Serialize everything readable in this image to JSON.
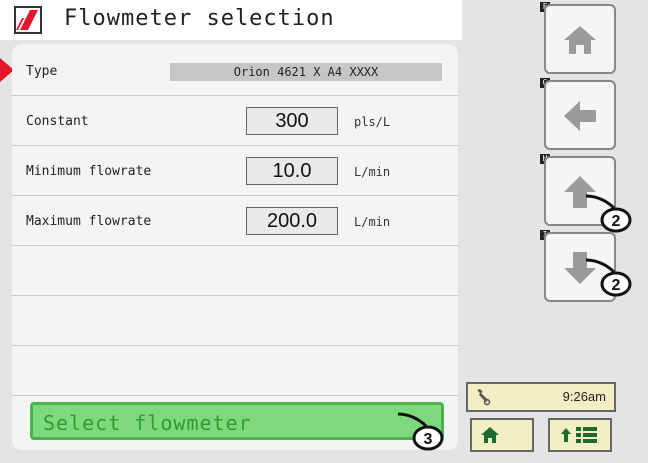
{
  "header": {
    "title": "Flowmeter selection"
  },
  "rows": [
    {
      "label": "Type",
      "value": "Orion 4621 X A4 XXXX"
    },
    {
      "label": "Constant",
      "value": "300",
      "unit": "pls/L"
    },
    {
      "label": "Minimum flowrate",
      "value": "10.0",
      "unit": "L/min"
    },
    {
      "label": "Maximum flowrate",
      "value": "200.0",
      "unit": "L/min"
    }
  ],
  "actions": {
    "select_label": "Select flowmeter"
  },
  "side_keys": [
    {
      "tag": "F",
      "icon": "home-icon"
    },
    {
      "tag": "G",
      "icon": "arrow-left-icon"
    },
    {
      "tag": "H",
      "icon": "arrow-up-icon"
    },
    {
      "tag": "I",
      "icon": "arrow-down-icon"
    }
  ],
  "callouts": {
    "up": "2",
    "down": "2",
    "select": "3"
  },
  "status": {
    "time": "9:26am"
  },
  "colors": {
    "accent_red": "#e3162a",
    "select_green": "#7ed97e",
    "status_bg": "#f3eec4"
  }
}
